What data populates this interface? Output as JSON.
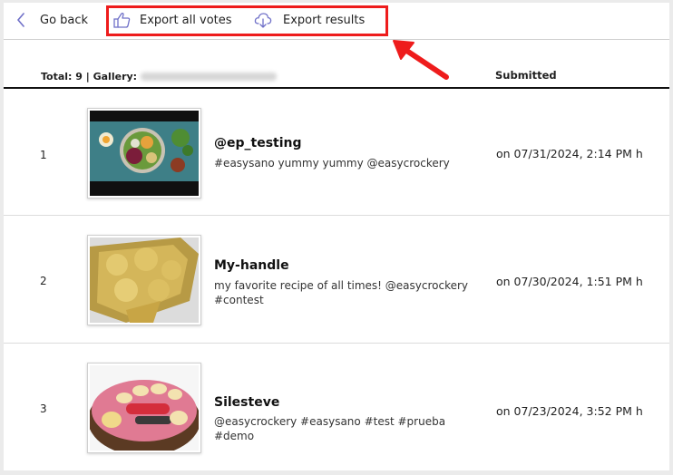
{
  "toolbar": {
    "back_label": "Go back",
    "export_votes_label": "Export all votes",
    "export_results_label": "Export results"
  },
  "table": {
    "total_label": "Total: 9 | Gallery:",
    "submitted_header": "Submitted",
    "rows": [
      {
        "index": "1",
        "handle": "@ep_testing",
        "caption": "#easysano yummy yummy @easycrockery",
        "submitted": "on 07/31/2024, 2:14 PM h"
      },
      {
        "index": "2",
        "handle": "My-handle",
        "caption": "my favorite recipe of all times! @easycrockery #contest",
        "submitted": "on 07/30/2024, 1:51 PM h"
      },
      {
        "index": "3",
        "handle": "Silesteve",
        "caption": "@easycrockery #easysano #test #prueba #demo",
        "submitted": "on 07/23/2024, 3:52 PM h"
      }
    ]
  },
  "colors": {
    "highlight": "#ee1c1c",
    "icon_accent": "#6f70c8"
  },
  "icons": {
    "back": "chevron-left-icon",
    "export_votes": "thumbs-up-icon",
    "export_results": "cloud-download-icon"
  }
}
